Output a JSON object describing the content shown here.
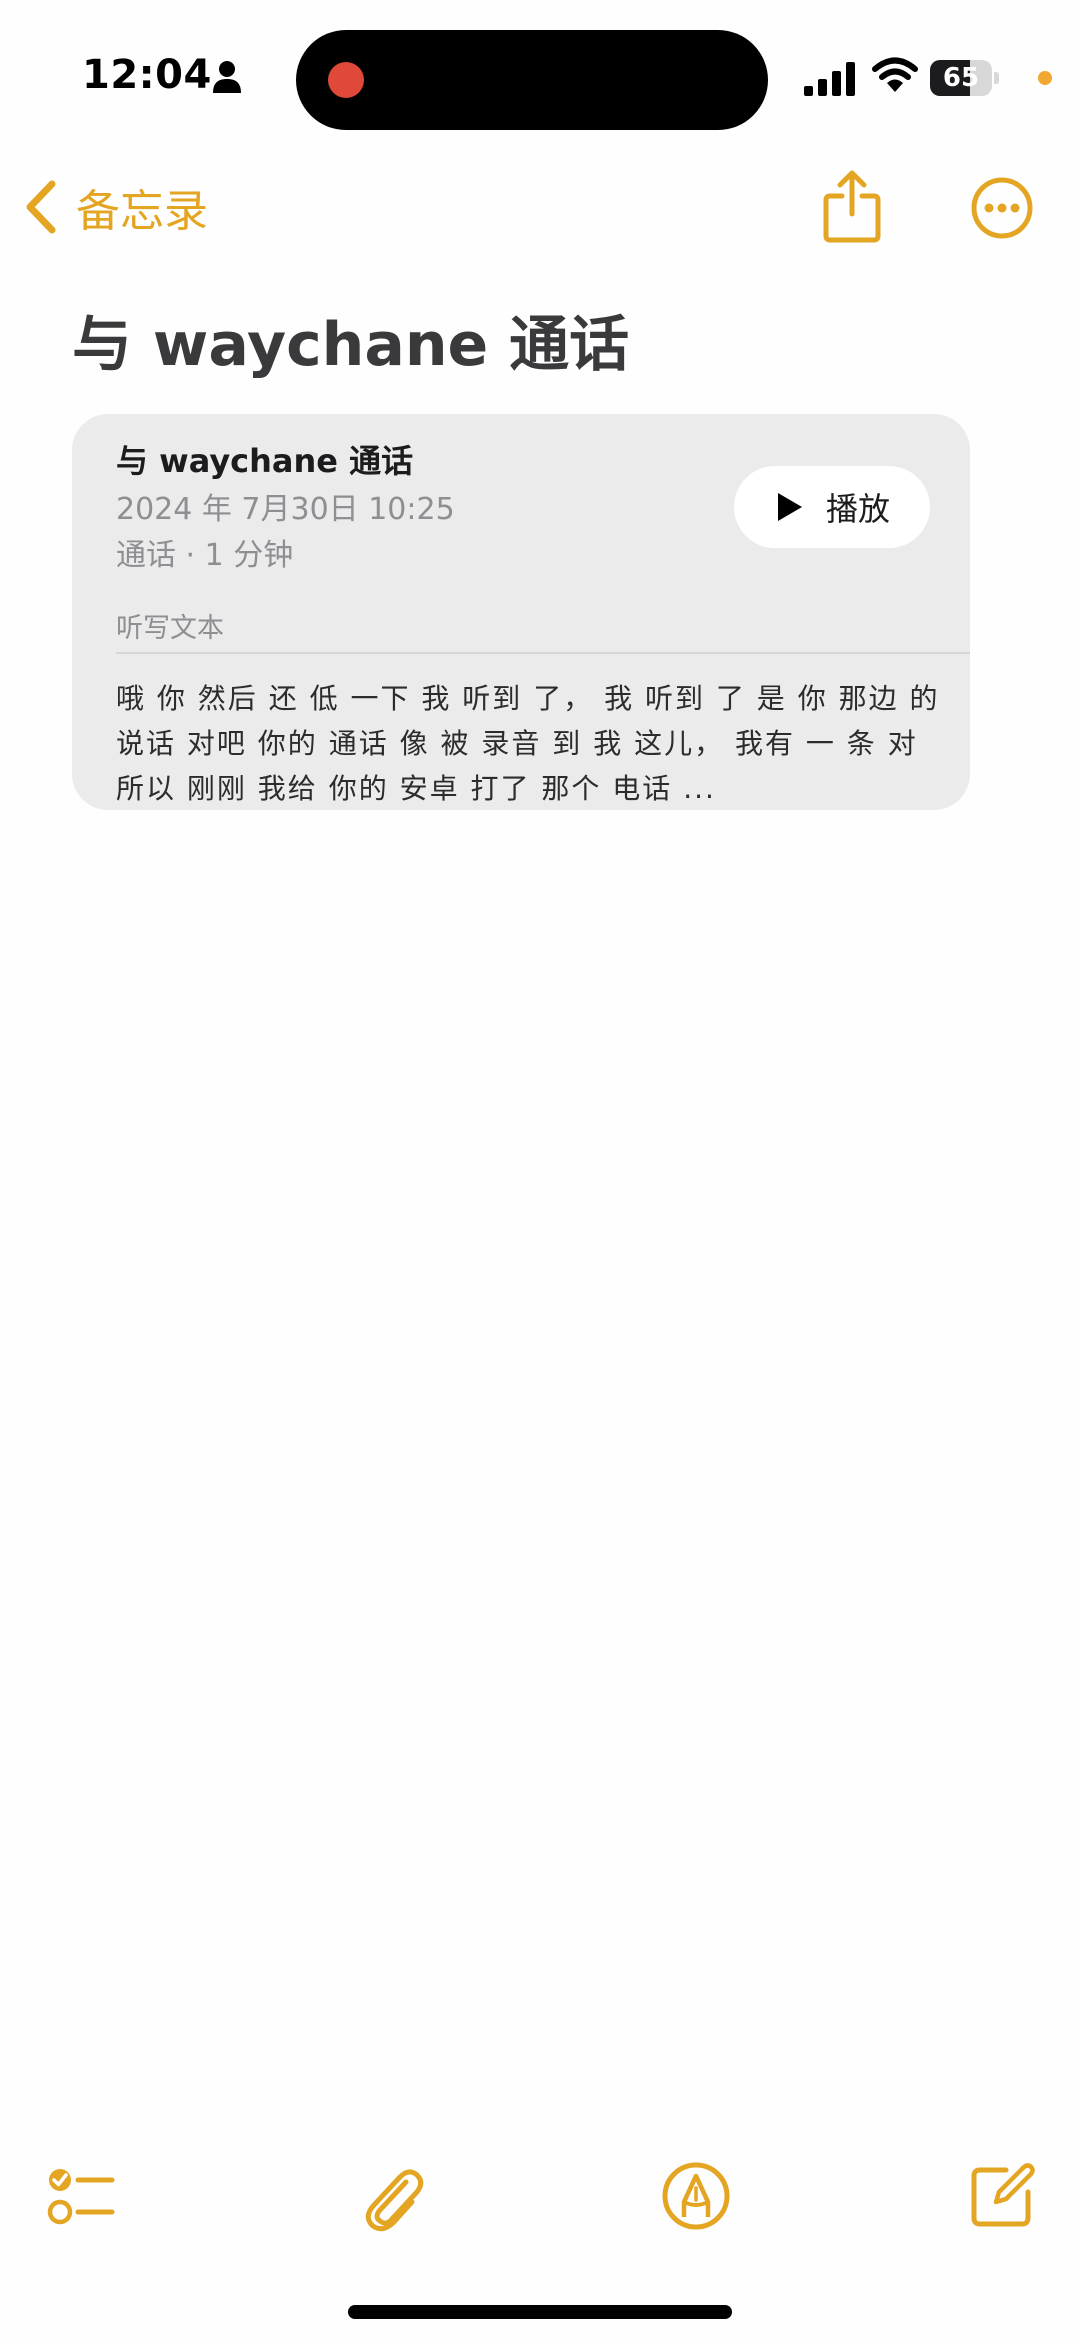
{
  "status_bar": {
    "time": "12:04",
    "battery_level": "65",
    "battery_fraction": 0.65
  },
  "nav": {
    "back_label": "备忘录"
  },
  "note": {
    "title": "与 waychane 通话"
  },
  "call_card": {
    "title": "与 waychane 通话",
    "datetime": "2024 年 7月30日 10:25",
    "meta": "通话 · 1 分钟",
    "play_label": "播放",
    "transcript_header": "听写文本",
    "transcript_lines": [
      "哦 你 然后 还 低 一下 我 听到 了， 我 听到 了 是 你 那边 的",
      "说话 对吧 你的 通话 像 被 录音 到 我 这儿， 我有 一 条 对",
      "所以 刚刚 我给 你的 安卓 打了 那个 电话 ..."
    ]
  },
  "colors": {
    "accent": "#E3A522",
    "recording": "#E0483A",
    "card_bg": "#EBEBEB"
  },
  "icons": {
    "back": "chevron-left-icon",
    "share": "share-icon",
    "more": "ellipsis-circle-icon",
    "play": "play-icon",
    "checklist": "checklist-icon",
    "attach": "paperclip-icon",
    "markup": "markup-pen-icon",
    "compose": "compose-icon"
  }
}
